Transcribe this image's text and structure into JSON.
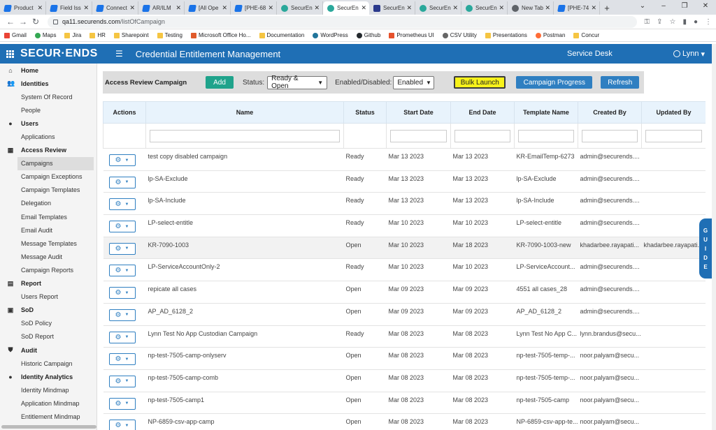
{
  "browser": {
    "tabs": [
      {
        "label": "Product",
        "icon": "blue"
      },
      {
        "label": "Field Iss",
        "icon": "blue"
      },
      {
        "label": "Connect",
        "icon": "blue"
      },
      {
        "label": "AR/ILM",
        "icon": "blue"
      },
      {
        "label": "[All Ope",
        "icon": "blue"
      },
      {
        "label": "[PHE-68",
        "icon": "blue"
      },
      {
        "label": "SecurEn",
        "icon": "teal"
      },
      {
        "label": "SecurEn",
        "icon": "teal",
        "active": true
      },
      {
        "label": "SecurEn",
        "icon": "navy"
      },
      {
        "label": "SecurEn",
        "icon": "teal"
      },
      {
        "label": "SecurEn",
        "icon": "teal"
      },
      {
        "label": "New Tab",
        "icon": "gray"
      },
      {
        "label": "[PHE-74",
        "icon": "blue"
      }
    ],
    "url_host": "qa11.securends.com",
    "url_path": "/listOfCampaign",
    "bookmarks": [
      {
        "label": "Gmail",
        "icon": "gmail"
      },
      {
        "label": "Maps",
        "icon": "maps"
      },
      {
        "label": "Jira",
        "icon": "folder"
      },
      {
        "label": "HR",
        "icon": "folder"
      },
      {
        "label": "Sharepoint",
        "icon": "folder"
      },
      {
        "label": "Testing",
        "icon": "folder"
      },
      {
        "label": "Microsoft Office Ho...",
        "icon": "ms"
      },
      {
        "label": "Documentation",
        "icon": "folder"
      },
      {
        "label": "WordPress",
        "icon": "wp"
      },
      {
        "label": "Github",
        "icon": "gh"
      },
      {
        "label": "Prometheus UI",
        "icon": "prom"
      },
      {
        "label": "CSV Utility",
        "icon": "csv"
      },
      {
        "label": "Presentations",
        "icon": "folder"
      },
      {
        "label": "Postman",
        "icon": "pm"
      },
      {
        "label": "Concur",
        "icon": "folder"
      }
    ]
  },
  "header": {
    "logo": "SECUR·ENDS",
    "title": "Credential Entitlement Management",
    "service_desk": "Service Desk",
    "user": "Lynn",
    "color": "#1f6fb5"
  },
  "sidebar": {
    "items": [
      {
        "label": "Home",
        "type": "sec",
        "icon": "home-icon",
        "glyph": "⌂"
      },
      {
        "label": "Identities",
        "type": "sec",
        "icon": "users-icon",
        "glyph": "👥"
      },
      {
        "label": "System Of Record",
        "type": "sub"
      },
      {
        "label": "People",
        "type": "sub"
      },
      {
        "label": "Users",
        "type": "sec",
        "icon": "user-icon",
        "glyph": "●"
      },
      {
        "label": "Applications",
        "type": "sub"
      },
      {
        "label": "Access Review",
        "type": "sec",
        "icon": "grid-icon",
        "glyph": "▦"
      },
      {
        "label": "Campaigns",
        "type": "sub",
        "active": true
      },
      {
        "label": "Campaign Exceptions",
        "type": "sub"
      },
      {
        "label": "Campaign Templates",
        "type": "sub"
      },
      {
        "label": "Delegation",
        "type": "sub"
      },
      {
        "label": "Email Templates",
        "type": "sub"
      },
      {
        "label": "Email Audit",
        "type": "sub"
      },
      {
        "label": "Message Templates",
        "type": "sub"
      },
      {
        "label": "Message Audit",
        "type": "sub"
      },
      {
        "label": "Campaign Reports",
        "type": "sub"
      },
      {
        "label": "Report",
        "type": "sec",
        "icon": "report-icon",
        "glyph": "▤"
      },
      {
        "label": "Users Report",
        "type": "sub"
      },
      {
        "label": "SoD",
        "type": "sec",
        "icon": "sod-icon",
        "glyph": "▣"
      },
      {
        "label": "SoD Policy",
        "type": "sub"
      },
      {
        "label": "SoD Report",
        "type": "sub"
      },
      {
        "label": "Audit",
        "type": "sec",
        "icon": "shield-icon",
        "glyph": "⛊"
      },
      {
        "label": "Historic Campaign",
        "type": "sub"
      },
      {
        "label": "Identity Analytics",
        "type": "sec",
        "icon": "analytics-icon",
        "glyph": "●"
      },
      {
        "label": "Identity Mindmap",
        "type": "sub"
      },
      {
        "label": "Application Mindmap",
        "type": "sub"
      },
      {
        "label": "Entitlement Mindmap",
        "type": "sub"
      }
    ]
  },
  "toolbar": {
    "title": "Access Review Campaign",
    "add_label": "Add",
    "status_label": "Status:",
    "status_value": "Ready & Open",
    "enabled_label": "Enabled/Disabled:",
    "enabled_value": "Enabled",
    "bulk_label": "Bulk Launch",
    "progress_label": "Campaign Progress",
    "refresh_label": "Refresh"
  },
  "table": {
    "headers": [
      "Actions",
      "Name",
      "Status",
      "Start Date",
      "End Date",
      "Template Name",
      "Created By",
      "Updated By"
    ],
    "rows": [
      {
        "name": "test copy disabled campaign",
        "status": "Ready",
        "start": "Mar 13 2023",
        "end": "Mar 13 2023",
        "template": "KR-EmailTemp-6273",
        "created": "admin@securends....",
        "updated": ""
      },
      {
        "name": "lp-SA-Exclude",
        "status": "Ready",
        "start": "Mar 13 2023",
        "end": "Mar 13 2023",
        "template": "lp-SA-Exclude",
        "created": "admin@securends....",
        "updated": ""
      },
      {
        "name": "lp-SA-Include",
        "status": "Ready",
        "start": "Mar 13 2023",
        "end": "Mar 13 2023",
        "template": "lp-SA-Include",
        "created": "admin@securends....",
        "updated": ""
      },
      {
        "name": "LP-select-entitle",
        "status": "Ready",
        "start": "Mar 10 2023",
        "end": "Mar 10 2023",
        "template": "LP-select-entitle",
        "created": "admin@securends....",
        "updated": ""
      },
      {
        "name": "KR-7090-1003",
        "status": "Open",
        "start": "Mar 10 2023",
        "end": "Mar 18 2023",
        "template": "KR-7090-1003-new",
        "created": "khadarbee.rayapati...",
        "updated": "khadarbee.rayapati...",
        "shade": true
      },
      {
        "name": "LP-ServiceAccountOnly-2",
        "status": "Ready",
        "start": "Mar 10 2023",
        "end": "Mar 10 2023",
        "template": "LP-ServiceAccount...",
        "created": "admin@securends....",
        "updated": ""
      },
      {
        "name": "repicate all cases",
        "status": "Open",
        "start": "Mar 09 2023",
        "end": "Mar 09 2023",
        "template": "4551 all cases_28",
        "created": "admin@securends....",
        "updated": ""
      },
      {
        "name": "AP_AD_6128_2",
        "status": "Open",
        "start": "Mar 09 2023",
        "end": "Mar 09 2023",
        "template": "AP_AD_6128_2",
        "created": "admin@securends....",
        "updated": ""
      },
      {
        "name": "Lynn Test No App Custodian Campaign",
        "status": "Ready",
        "start": "Mar 08 2023",
        "end": "Mar 08 2023",
        "template": "Lynn Test No App C...",
        "created": "lynn.brandus@secu...",
        "updated": ""
      },
      {
        "name": "np-test-7505-camp-onlyserv",
        "status": "Open",
        "start": "Mar 08 2023",
        "end": "Mar 08 2023",
        "template": "np-test-7505-temp-...",
        "created": "noor.palyam@secu...",
        "updated": ""
      },
      {
        "name": "np-test-7505-camp-comb",
        "status": "Open",
        "start": "Mar 08 2023",
        "end": "Mar 08 2023",
        "template": "np-test-7505-temp-...",
        "created": "noor.palyam@secu...",
        "updated": ""
      },
      {
        "name": "np-test-7505-camp1",
        "status": "Open",
        "start": "Mar 08 2023",
        "end": "Mar 08 2023",
        "template": "np-test-7505-camp",
        "created": "noor.palyam@secu...",
        "updated": ""
      },
      {
        "name": "NP-6859-csv-app-camp",
        "status": "Open",
        "start": "Mar 08 2023",
        "end": "Mar 08 2023",
        "template": "NP-6859-csv-app-te...",
        "created": "noor.palyam@secu...",
        "updated": ""
      }
    ]
  },
  "guide_label": "GUIDE"
}
